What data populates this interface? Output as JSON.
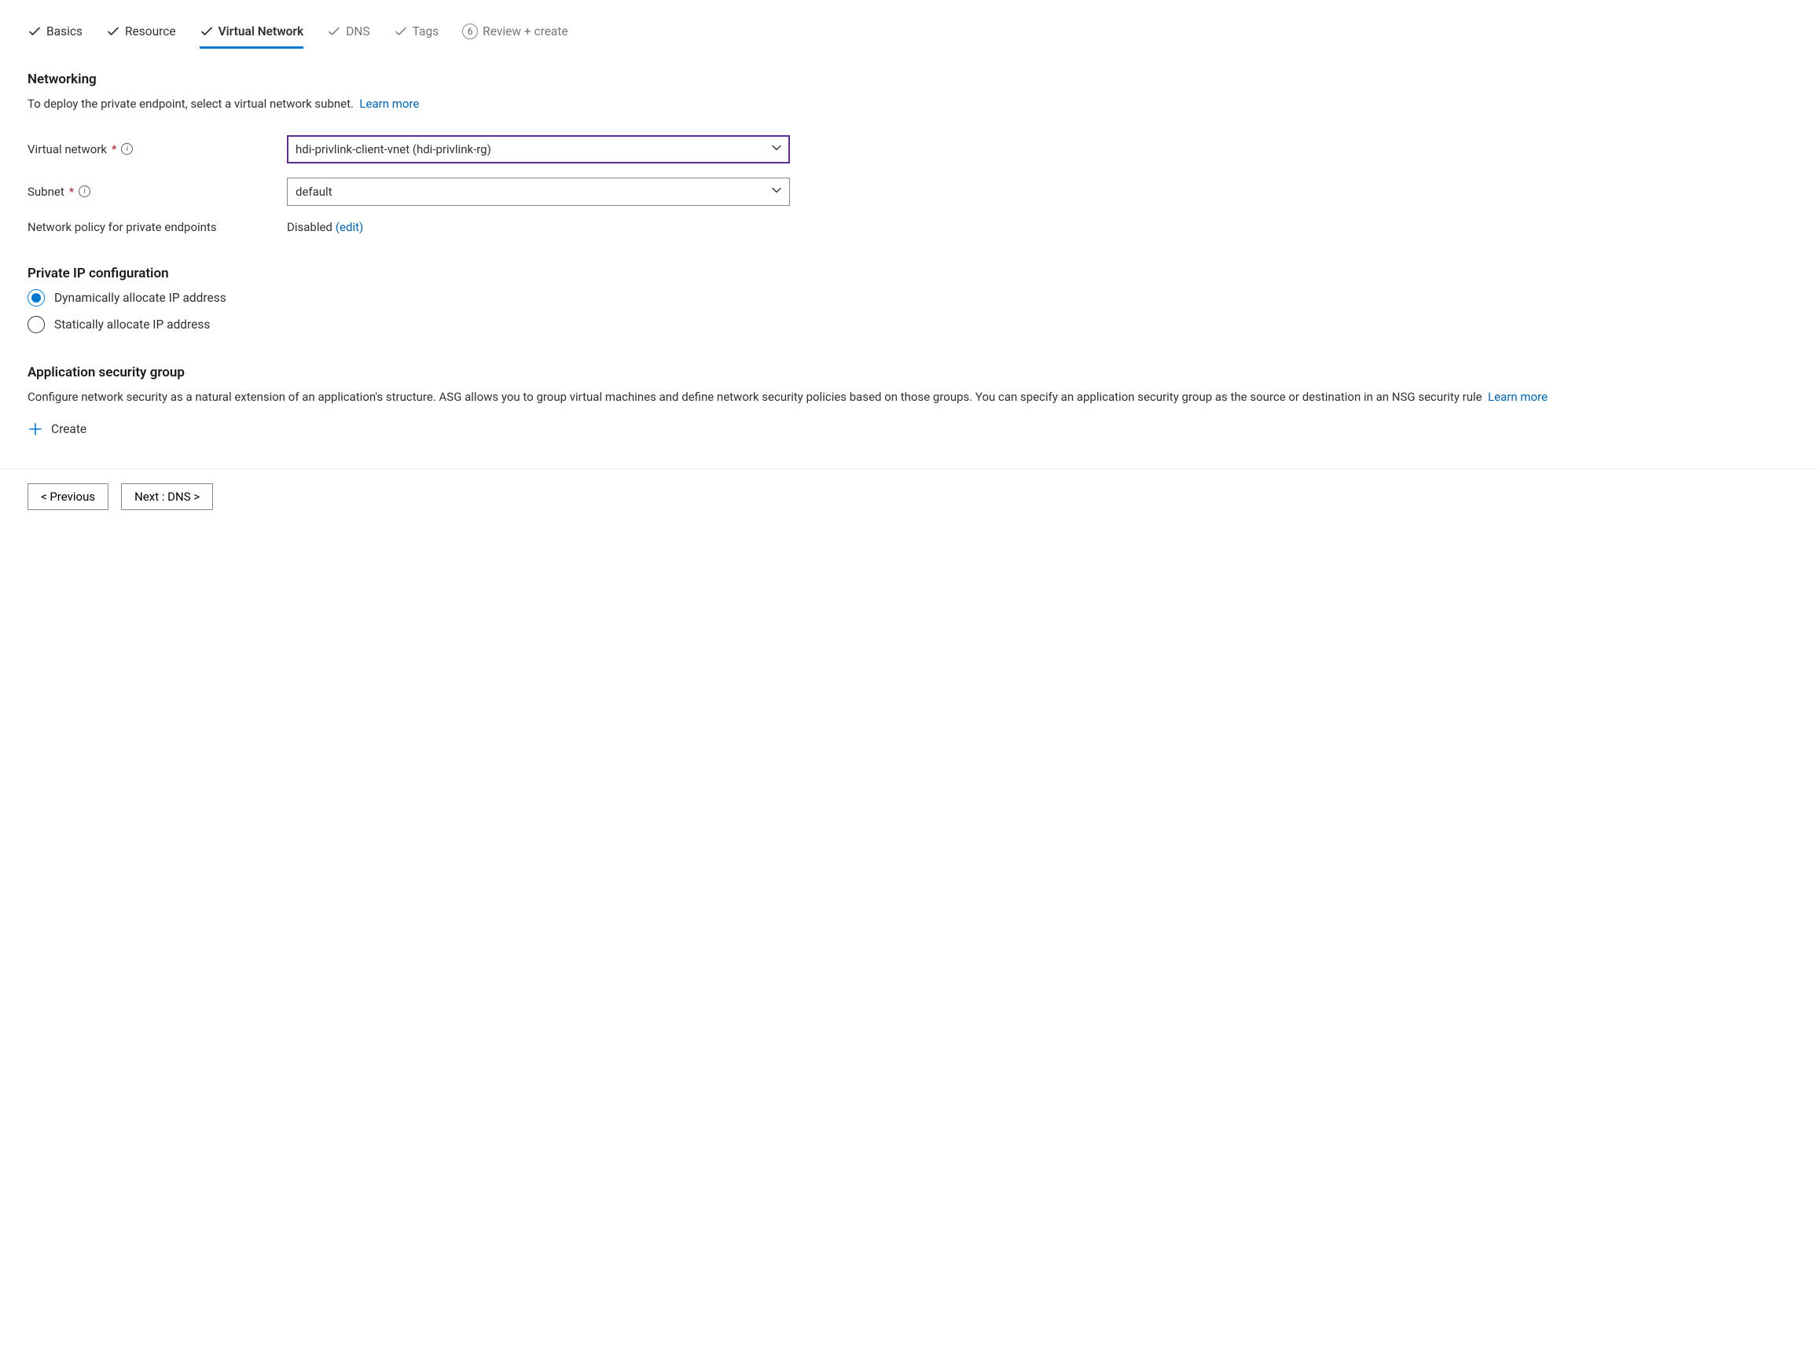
{
  "tabs": {
    "basics": "Basics",
    "resource": "Resource",
    "virtual_network": "Virtual Network",
    "dns": "DNS",
    "tags": "Tags",
    "review_create": "Review + create",
    "review_step_num": "6"
  },
  "networking": {
    "heading": "Networking",
    "desc": "To deploy the private endpoint, select a virtual network subnet.",
    "learn_more": "Learn more",
    "vnet_label": "Virtual network",
    "vnet_value": "hdi-privlink-client-vnet (hdi-privlink-rg)",
    "subnet_label": "Subnet",
    "subnet_value": "default",
    "policy_label": "Network policy for private endpoints",
    "policy_value": "Disabled",
    "policy_edit": "(edit)"
  },
  "private_ip": {
    "heading": "Private IP configuration",
    "option_dynamic": "Dynamically allocate IP address",
    "option_static": "Statically allocate IP address"
  },
  "asg": {
    "heading": "Application security group",
    "desc": "Configure network security as a natural extension of an application's structure. ASG allows you to group virtual machines and define network security policies based on those groups. You can specify an application security group as the source or destination in an NSG security rule",
    "learn_more": "Learn more",
    "create": "Create"
  },
  "footer": {
    "previous": "< Previous",
    "next": "Next : DNS >"
  }
}
